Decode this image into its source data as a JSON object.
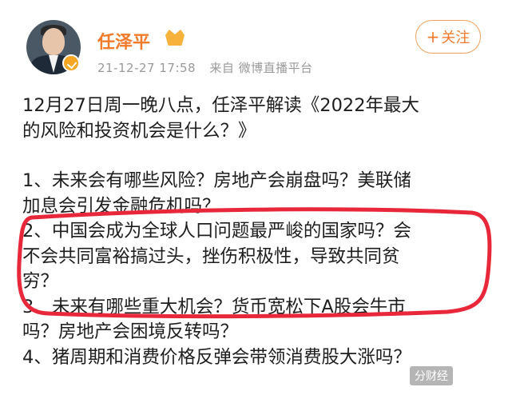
{
  "post": {
    "author_name": "任泽平",
    "timestamp": "21-12-27 17:58",
    "source": "来自 微博直播平台",
    "follow_label": "关注",
    "follow_plus": "+",
    "avatar_icon": "avatar-photo",
    "verified_icon": "verified-badge-icon",
    "vip_icon": "crown-vip-icon"
  },
  "content": {
    "intro_line1": "12月27日周一晚八点，任泽平解读《2022年最大",
    "intro_line2": "的风险和投资机会是什么？》",
    "q1_line1": "1、未来会有哪些风险？房地产会崩盘吗？美联储",
    "q1_line2": "加息会引发金融危机吗？",
    "q2_line1": "2、中国会成为全球人口问题最严峻的国家吗？会",
    "q2_line2": "不会共同富裕搞过头，挫伤积极性，导致共同贫",
    "q2_line3": "穷？",
    "q3_line1": "3、未来有哪些重大机会？货币宽松下A股会牛市",
    "q3_line2": "吗？房地产会困境反转吗？",
    "q4_line1": "4、猪周期和消费价格反弹会带领消费股大涨吗？"
  },
  "watermark": "分财经",
  "colors": {
    "accent_orange": "#f27a2b",
    "highlight_red": "#e8283a",
    "meta_gray": "#9a9a9a"
  }
}
